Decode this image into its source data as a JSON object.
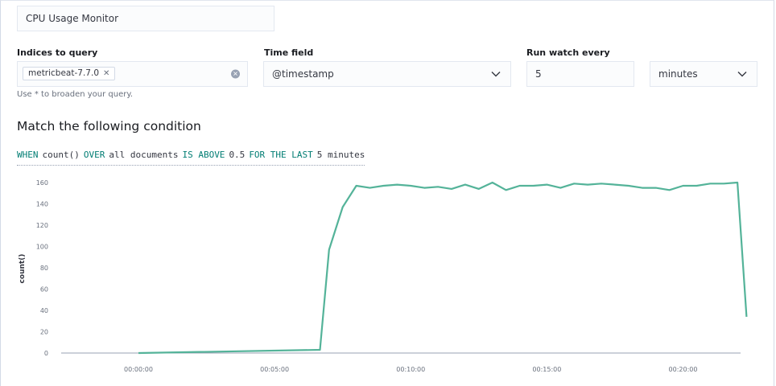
{
  "form": {
    "name_value": "CPU Usage Monitor",
    "indices_label": "Indices to query",
    "index_pill": "metricbeat-7.7.0",
    "indices_help": "Use * to broaden your query.",
    "time_field_label": "Time field",
    "time_field_value": "@timestamp",
    "run_every_label": "Run watch every",
    "run_every_value": "5",
    "run_every_unit": "minutes"
  },
  "condition": {
    "heading": "Match the following condition",
    "parts": [
      {
        "text": "WHEN",
        "kw": true
      },
      {
        "text": "count()",
        "kw": false
      },
      {
        "text": "OVER",
        "kw": true
      },
      {
        "text": "all documents",
        "kw": false
      },
      {
        "text": "IS ABOVE",
        "kw": true
      },
      {
        "text": "0.5",
        "kw": false
      },
      {
        "text": "FOR THE LAST",
        "kw": true
      },
      {
        "text": "5 minutes",
        "kw": false
      }
    ]
  },
  "colors": {
    "series": "#54b399",
    "keyword": "#017d73",
    "axis": "#69707d"
  },
  "chart_data": {
    "type": "line",
    "ylabel": "count()",
    "xlabel": "",
    "ylim": [
      0,
      160
    ],
    "yticks": [
      0,
      20,
      40,
      60,
      80,
      100,
      120,
      140,
      160
    ],
    "xlim": [
      "00:00:00",
      "00:22:20"
    ],
    "xticks": [
      "00:00:00",
      "00:05:00",
      "00:10:00",
      "00:15:00",
      "00:20:00"
    ],
    "grid": false,
    "series": [
      {
        "name": "",
        "x": [
          "00:00:00",
          "00:06:40",
          "00:07:00",
          "00:07:30",
          "00:08:00",
          "00:08:30",
          "00:09:00",
          "00:09:30",
          "00:10:00",
          "00:10:30",
          "00:11:00",
          "00:11:30",
          "00:12:00",
          "00:12:30",
          "00:13:00",
          "00:13:30",
          "00:14:00",
          "00:14:30",
          "00:15:00",
          "00:15:30",
          "00:16:00",
          "00:16:30",
          "00:17:00",
          "00:17:30",
          "00:18:00",
          "00:18:30",
          "00:19:00",
          "00:19:30",
          "00:20:00",
          "00:20:30",
          "00:21:00",
          "00:21:30",
          "00:22:00",
          "00:22:20"
        ],
        "values": [
          0,
          3,
          97,
          137,
          157,
          155,
          157,
          158,
          157,
          155,
          156,
          154,
          158,
          154,
          160,
          153,
          157,
          157,
          158,
          155,
          159,
          158,
          159,
          158,
          157,
          155,
          155,
          153,
          157,
          157,
          159,
          159,
          160,
          34
        ]
      }
    ]
  }
}
